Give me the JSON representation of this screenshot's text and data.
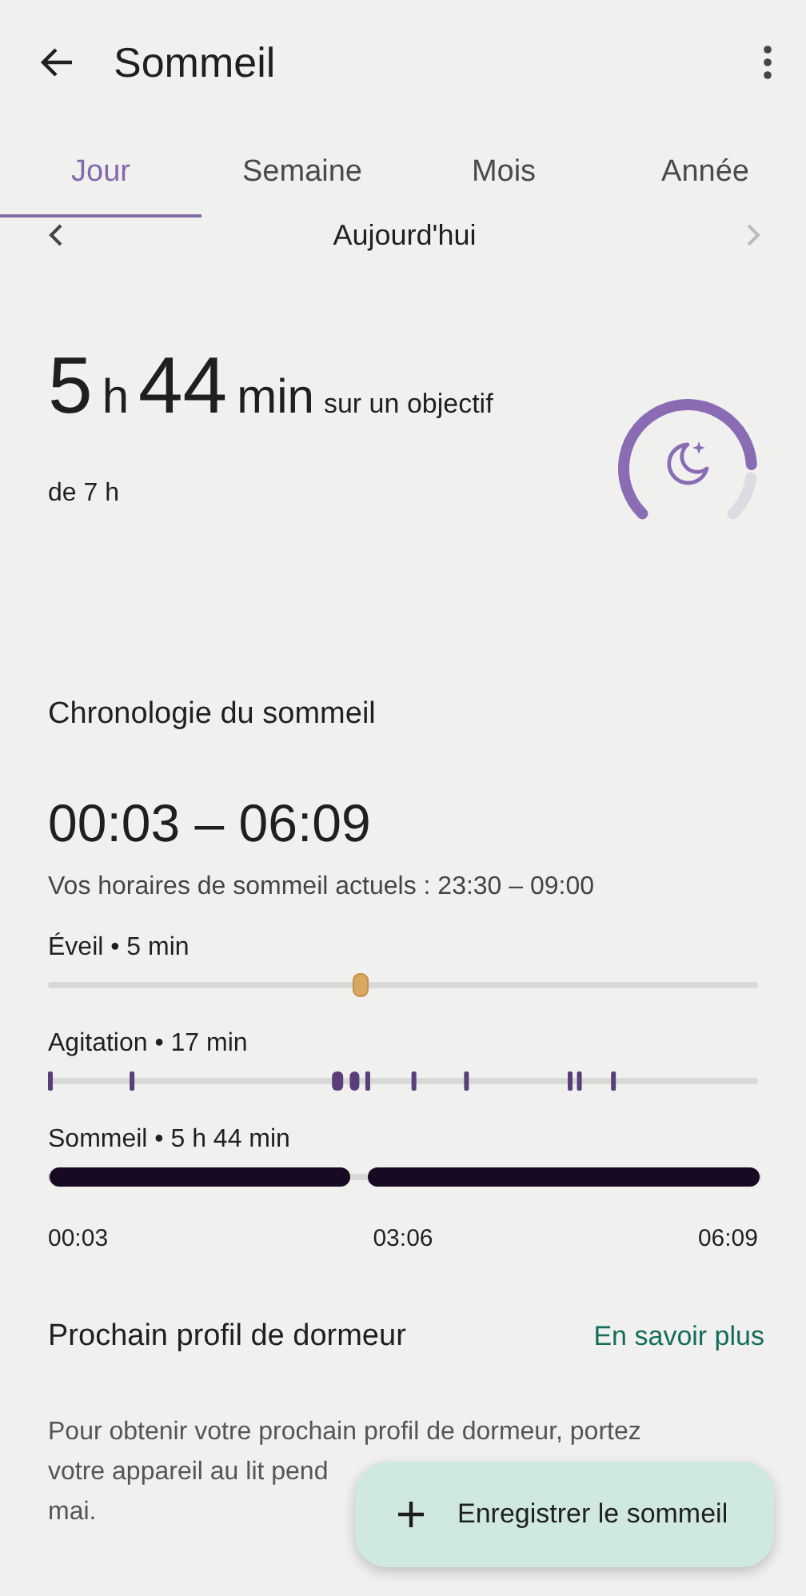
{
  "app_bar": {
    "title": "Sommeil"
  },
  "tabs": [
    {
      "label": "Jour",
      "selected": true
    },
    {
      "label": "Semaine",
      "selected": false
    },
    {
      "label": "Mois",
      "selected": false
    },
    {
      "label": "Année",
      "selected": false
    }
  ],
  "date_nav": {
    "label": "Aujourd'hui"
  },
  "summary": {
    "hours": "5",
    "hours_unit": "h",
    "minutes": "44",
    "minutes_unit": "min",
    "goal_prefix": "sur un objectif",
    "goal_suffix": "de 7 h"
  },
  "timeline": {
    "title": "Chronologie du sommeil",
    "range": "00:03 – 06:09",
    "schedule": "Vos horaires de sommeil actuels : 23:30 – 09:00",
    "stages": [
      {
        "kind": "awake",
        "label": "Éveil • 5 min"
      },
      {
        "kind": "restless",
        "label": "Agitation • 17 min"
      },
      {
        "kind": "asleep",
        "label": "Sommeil • 5 h 44 min"
      }
    ],
    "axis_labels": [
      "00:03",
      "03:06",
      "06:09"
    ]
  },
  "sleeper_profile": {
    "title": "Prochain profil de dormeur",
    "link": "En savoir plus",
    "text_lines": [
      "Pour obtenir votre prochain profil de dormeur, portez",
      "votre appareil au lit pend",
      "mai."
    ]
  },
  "fab": {
    "label": "Enregistrer le sommeil"
  }
}
